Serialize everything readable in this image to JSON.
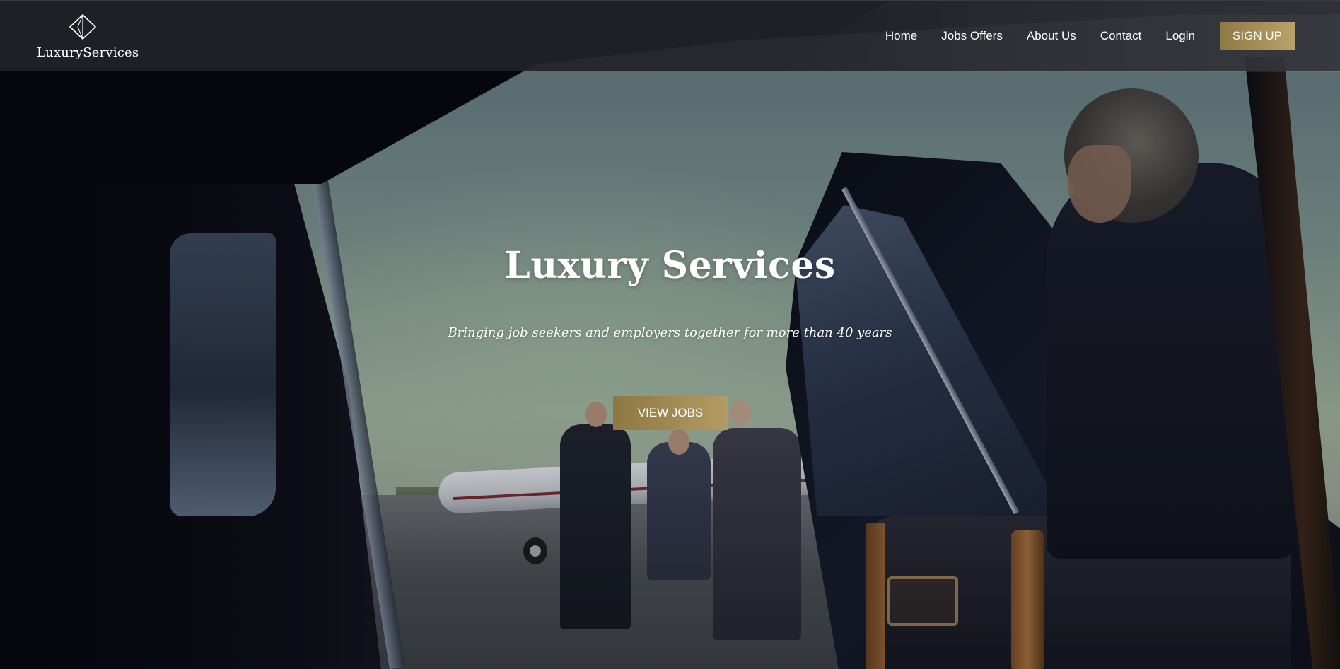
{
  "brand": {
    "name": "LuxuryServices",
    "logo_icon": "diamond-icon"
  },
  "nav": {
    "items": [
      {
        "label": "Home"
      },
      {
        "label": "Jobs Offers"
      },
      {
        "label": "About Us"
      },
      {
        "label": "Contact"
      },
      {
        "label": "Login"
      }
    ],
    "signup_label": "SIGN UP"
  },
  "hero": {
    "title": "Luxury Services",
    "subtitle": "Bringing job seekers and employers together for more than 40 years",
    "cta_label": "VIEW JOBS"
  },
  "colors": {
    "navbar_bg": "#222328",
    "accent_gold": "#a8915a",
    "text": "#ffffff"
  }
}
